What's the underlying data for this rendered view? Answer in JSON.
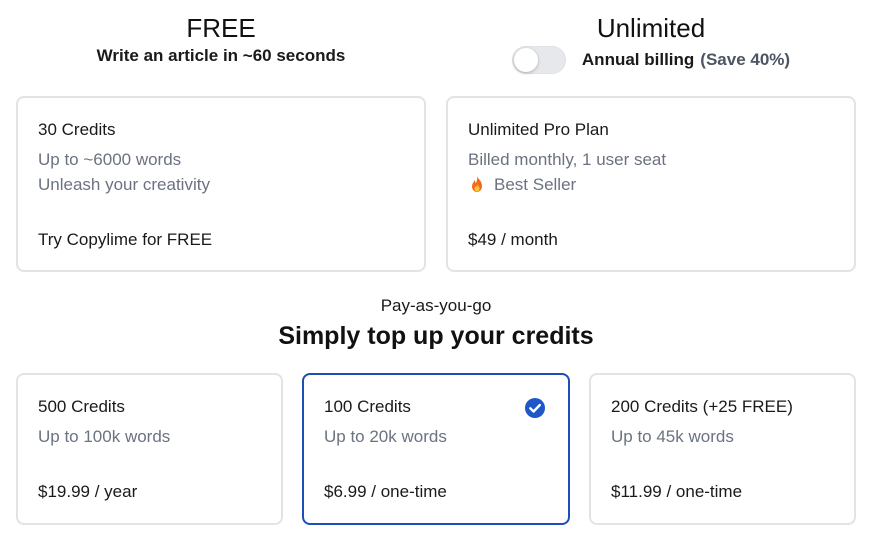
{
  "free": {
    "title": "FREE",
    "subtitle": "Write an article in ~60 seconds",
    "card": {
      "title": "30 Credits",
      "line1": "Up to ~6000 words",
      "line2": "Unleash your creativity",
      "cta": "Try Copylime for FREE"
    }
  },
  "unlimited": {
    "title": "Unlimited",
    "billing": {
      "toggle_on": false,
      "label": "Annual billing",
      "save": "(Save 40%)"
    },
    "card": {
      "title": "Unlimited Pro Plan",
      "line1": "Billed monthly, 1 user seat",
      "badge_icon": "fire-icon",
      "badge": "Best Seller",
      "price": "$49 / month"
    }
  },
  "payg": {
    "kicker": "Pay-as-you-go",
    "title": "Simply top up your credits",
    "options": [
      {
        "title": "500 Credits",
        "line1": "Up to 100k words",
        "price": "$19.99 / year",
        "selected": false
      },
      {
        "title": "100 Credits",
        "line1": "Up to 20k words",
        "price": "$6.99 / one-time",
        "selected": true
      },
      {
        "title": "200 Credits (+25 FREE)",
        "line1": "Up to 45k words",
        "price": "$11.99 / one-time",
        "selected": false
      }
    ]
  },
  "colors": {
    "selected_border": "#1f4fb6",
    "card_border": "#e1e3e6",
    "muted_text": "#6b7280",
    "check_fill": "#1f57c9"
  }
}
